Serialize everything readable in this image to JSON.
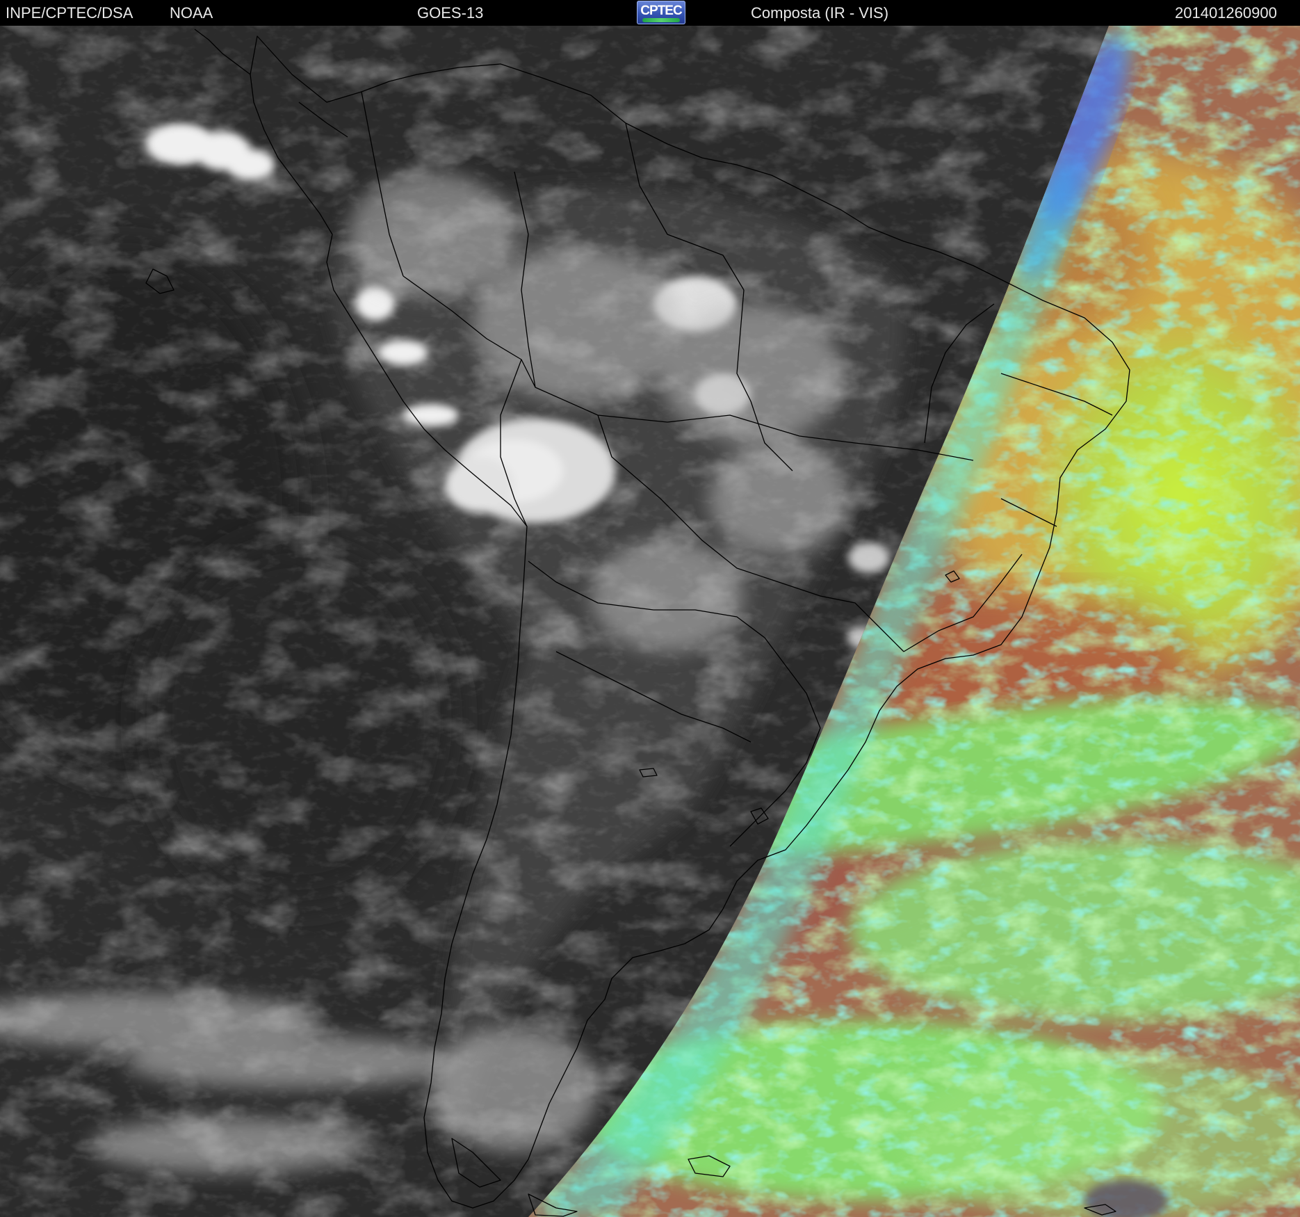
{
  "header": {
    "agency": "INPE/CPTEC/DSA",
    "partner": "NOAA",
    "satellite": "GOES-13",
    "logo_text": "CPTEC",
    "product": "Composta (IR - VIS)",
    "datetime": "201401260900"
  },
  "colors": {
    "night_background": "#2a2a2a",
    "cloud_white": "#f2f2f2",
    "coastline": "#000000",
    "day_ocean_yellow": "#c7e84a",
    "day_ocean_orange": "#d9a54b",
    "day_ocean_brown": "#9e6a52",
    "day_cloud_green": "#85ec72",
    "day_cloud_cyan": "#4fe6d2",
    "day_cloud_blue": "#4f6ef0"
  }
}
